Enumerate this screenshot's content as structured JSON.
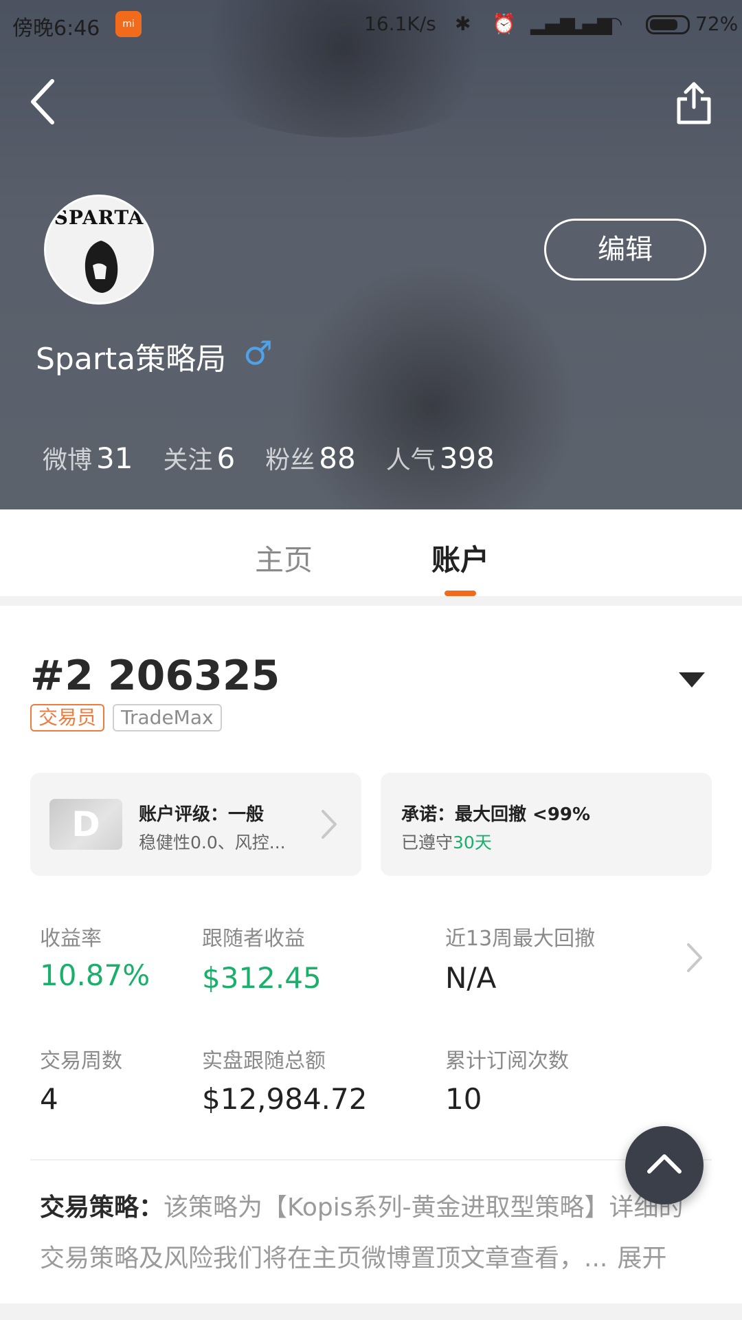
{
  "status_bar": {
    "time": "傍晚6:46",
    "mi_label": "mi",
    "network_speed": "16.1K/s",
    "battery": "72%"
  },
  "profile": {
    "avatar_text": "SPARTA",
    "name": "Sparta策略局",
    "gender_symbol": "♂",
    "edit_label": "编辑",
    "stats": [
      {
        "label": "微博",
        "value": "31"
      },
      {
        "label": "关注",
        "value": "6"
      },
      {
        "label": "粉丝",
        "value": "88"
      },
      {
        "label": "人气",
        "value": "398"
      }
    ]
  },
  "tabs": {
    "home": "主页",
    "account": "账户",
    "active": "account"
  },
  "account": {
    "id": "#2 206325",
    "badge_role": "交易员",
    "badge_platform": "TradeMax",
    "rating_card": {
      "grade": "D",
      "title": "账户评级：一般",
      "detail": "稳健性0.0、风控..."
    },
    "promise_card": {
      "title": "承诺：最大回撤 <99%",
      "kept_prefix": "已遵守",
      "kept_days": "30天"
    },
    "metrics": [
      {
        "label": "收益率",
        "value": "10.87%",
        "highlight": true
      },
      {
        "label": "跟随者收益",
        "value": "$312.45",
        "highlight": true
      },
      {
        "label": "近13周最大回撤",
        "value": "N/A",
        "highlight": false
      },
      {
        "label": "交易周数",
        "value": "4",
        "highlight": false
      },
      {
        "label": "实盘跟随总额",
        "value": "$12,984.72",
        "highlight": false
      },
      {
        "label": "累计订阅次数",
        "value": "10",
        "highlight": false
      }
    ],
    "strategy": {
      "label": "交易策略：",
      "text": "该策略为【Kopis系列-黄金进取型策略】详细的交易策略及风险我们将在主页微博置顶文章查看，...",
      "expand": "展开"
    }
  },
  "colors": {
    "accent": "#f26a1b",
    "green": "#1aaf6a",
    "gender": "#4fa1e8",
    "header_bg": "#555b66"
  },
  "icons": [
    "back-arrow-icon",
    "share-icon",
    "male-icon",
    "chevron-right-icon",
    "caret-down-icon",
    "arrow-up-icon"
  ]
}
